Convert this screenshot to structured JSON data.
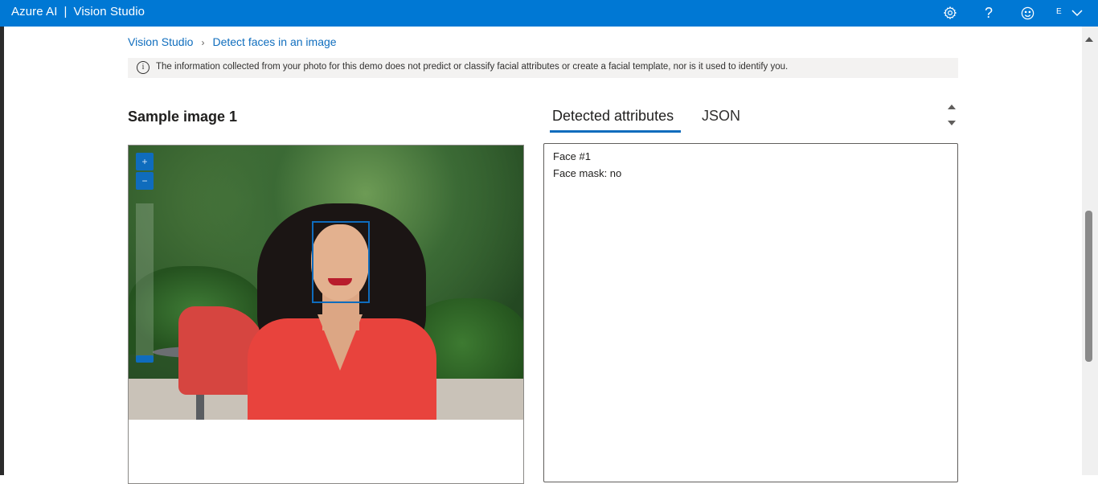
{
  "app": {
    "brand": "Azure AI",
    "separator": "|",
    "product": "Vision Studio",
    "user_initial": "E"
  },
  "header_icons": [
    "gear-icon",
    "help-icon",
    "feedback-smiley-icon",
    "chevron-down-icon"
  ],
  "breadcrumb": {
    "root": "Vision Studio",
    "current": "Detect faces in an image"
  },
  "banner": {
    "icon": "info-icon",
    "text": "The information collected from your photo for this demo does not predict or classify facial attributes or create a facial template, nor is it used to identify you."
  },
  "sample": {
    "title": "Sample image 1",
    "zoom_in": "+",
    "zoom_out": "−"
  },
  "tabs": {
    "attributes": "Detected attributes",
    "json": "JSON"
  },
  "results": {
    "face_label": "Face #1",
    "mask": "Face mask: no"
  },
  "colors": {
    "topbar": "#0078d4",
    "accent": "#0f6cbd",
    "banner_bg": "#f3f2f1"
  }
}
